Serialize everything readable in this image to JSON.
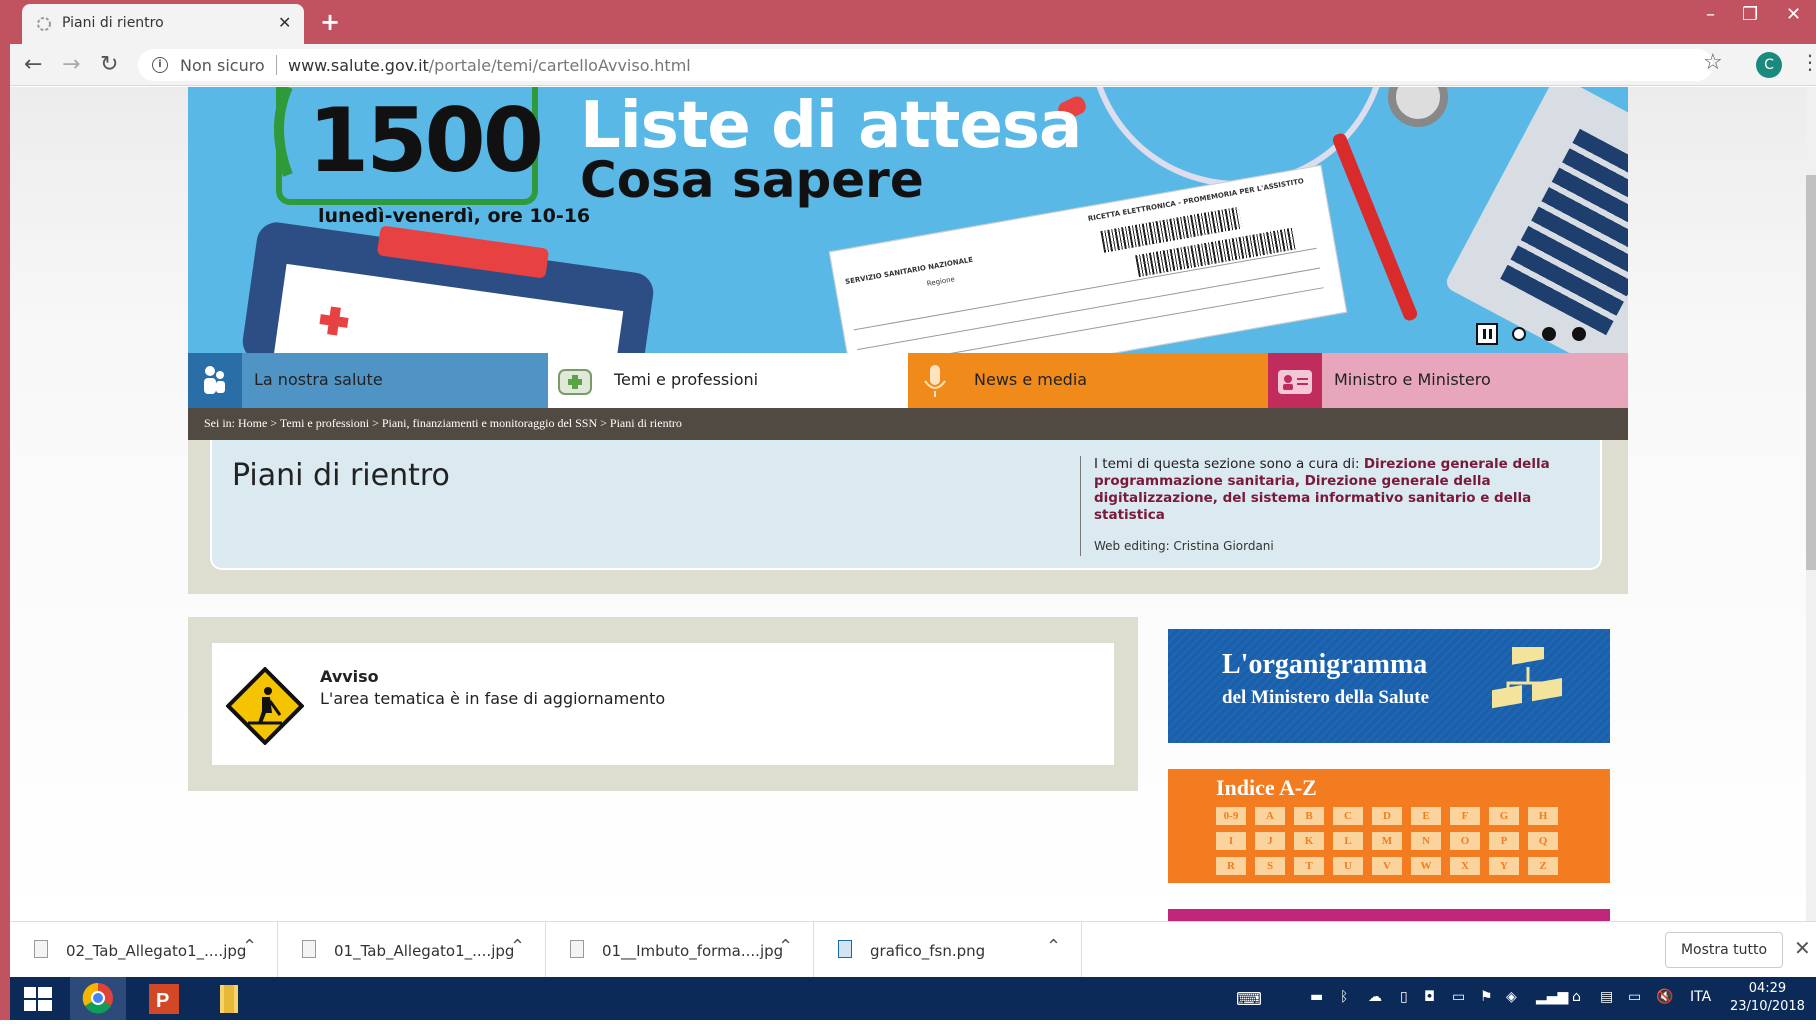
{
  "browser": {
    "tab_title": "Piani di rientro",
    "new_tab": "+",
    "security_label": "Non sicuro",
    "url_host": "www.salute.gov.it",
    "url_path": "/portale/temi/cartelloAvviso.html",
    "profile_initial": "C",
    "window_controls": [
      "–",
      "❐",
      "✕"
    ]
  },
  "banner": {
    "number": "1500",
    "hours": "lunedì-venerdì, ore 10-16",
    "title": "Liste di attesa",
    "subtitle": "Cosa sapere",
    "prescription_heading": "RICETTA ELETTRONICA - PROMEMORIA PER L'ASSISTITO",
    "prescription_service": "SERVIZIO SANITARIO NAZIONALE",
    "prescription_region": "Regione"
  },
  "menu": [
    {
      "label": "La nostra salute",
      "color": "#4f94c4",
      "icon_bg": "#2a6ea8"
    },
    {
      "label": "Temi e professioni",
      "color": "#ffffff",
      "icon_bg": "#ffffff"
    },
    {
      "label": "News e media",
      "color": "#f4c080",
      "icon_bg": "#f08a1a"
    },
    {
      "label": "Ministro e Ministero",
      "color": "#e8a6bd",
      "icon_bg": "#c02d5c"
    }
  ],
  "breadcrumb": {
    "prefix": "Sei in:",
    "items": [
      "Home",
      "Temi e professioni",
      "Piani, finanziamenti e monitoraggio del SSN",
      "Piani di rientro"
    ],
    "separator": ">"
  },
  "page": {
    "title": "Piani di rientro",
    "curator_intro": "I temi di questa sezione sono a cura di:",
    "curator_links": "Direzione generale della programmazione sanitaria, Direzione generale della digitalizzazione, del sistema informativo sanitario e della statistica",
    "web_editing": "Web editing: Cristina Giordani"
  },
  "notice": {
    "title": "Avviso",
    "text": "L'area tematica è in fase di aggiornamento"
  },
  "side": {
    "organ_title": "L'organigramma",
    "organ_sub": "del Ministero della Salute",
    "index_title": "Indice A-Z",
    "index_keys": [
      [
        "0-9",
        "A",
        "B",
        "C",
        "D",
        "E",
        "F",
        "G",
        "H"
      ],
      [
        "I",
        "J",
        "K",
        "L",
        "M",
        "N",
        "O",
        "P",
        "Q"
      ],
      [
        "R",
        "S",
        "T",
        "U",
        "V",
        "W",
        "X",
        "Y",
        "Z"
      ]
    ]
  },
  "downloads": [
    {
      "name": "02_Tab_Allegato1_....jpg",
      "icon": "image-file-icon"
    },
    {
      "name": "01_Tab_Allegato1_....jpg",
      "icon": "image-file-icon"
    },
    {
      "name": "01__Imbuto_forma....jpg",
      "icon": "image-file-icon"
    },
    {
      "name": "grafico_fsn.png",
      "icon": "picture-file-icon"
    }
  ],
  "downloads_show_all": "Mostra tutto",
  "taskbar": {
    "language": "ITA",
    "time": "04:29",
    "date": "23/10/2018"
  }
}
